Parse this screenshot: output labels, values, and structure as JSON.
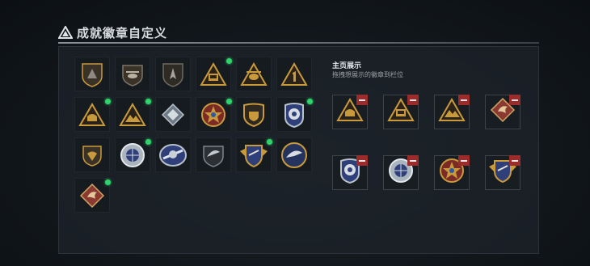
{
  "header": {
    "title": "成就徽章自定义",
    "title_icon": "triangle-logo-icon"
  },
  "showcase": {
    "title": "主页展示",
    "subtitle": "拖拽想展示的徽章到栏位"
  },
  "colors": {
    "accent_green": "#2fd36b",
    "remove_red": "#9c2b2b",
    "gold": "#c99a3c"
  },
  "badges": [
    {
      "name": "badge-shield-triangle-gold-icon",
      "new": false
    },
    {
      "name": "badge-helicopter-icon",
      "new": false
    },
    {
      "name": "badge-plane-shield-icon",
      "new": false
    },
    {
      "name": "badge-triangle-tank-icon",
      "new": true
    },
    {
      "name": "badge-triangle-helicopter-icon",
      "new": false
    },
    {
      "name": "badge-triangle-number-one-icon",
      "new": false
    },
    {
      "name": "badge-triangle-helmet-icon",
      "new": true
    },
    {
      "name": "badge-triangle-mountain-icon",
      "new": true
    },
    {
      "name": "badge-silver-diamond-icon",
      "new": false
    },
    {
      "name": "badge-star-laurel-icon",
      "new": true
    },
    {
      "name": "badge-shield-gold-icon",
      "new": false
    },
    {
      "name": "badge-blue-police-icon",
      "new": true
    },
    {
      "name": "badge-eagle-shield-icon",
      "new": false
    },
    {
      "name": "badge-silver-round-globe-icon",
      "new": true
    },
    {
      "name": "badge-silver-blue-emblem-icon",
      "new": false
    },
    {
      "name": "badge-silver-eagle-icon",
      "new": false
    },
    {
      "name": "badge-gold-winged-icon",
      "new": true
    },
    {
      "name": "badge-blue-round-eagle-icon",
      "new": false
    },
    {
      "name": "badge-dragon-diamond-icon",
      "new": true
    }
  ],
  "showcase_slots": [
    {
      "name": "badge-triangle-helmet-icon"
    },
    {
      "name": "badge-triangle-tank-icon"
    },
    {
      "name": "badge-triangle-mountain-icon"
    },
    {
      "name": "badge-dragon-diamond-icon"
    },
    {
      "name": "badge-blue-police-icon"
    },
    {
      "name": "badge-silver-round-globe-icon"
    },
    {
      "name": "badge-star-laurel-icon"
    },
    {
      "name": "badge-gold-winged-icon"
    }
  ]
}
